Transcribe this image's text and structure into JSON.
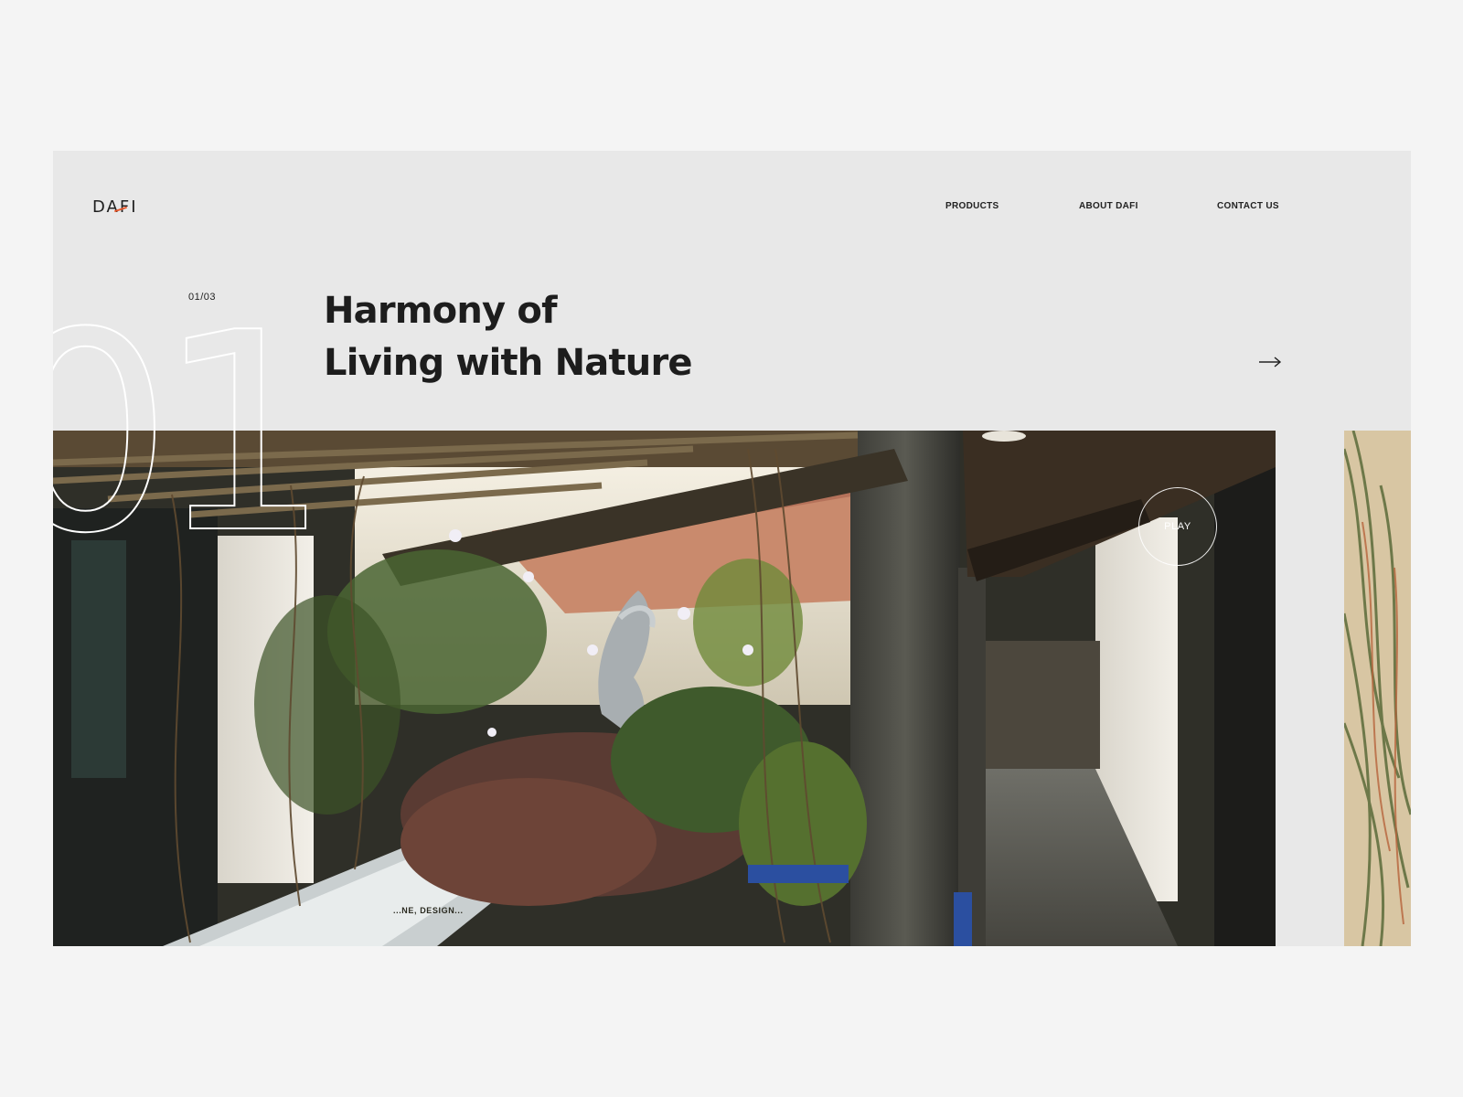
{
  "brand": {
    "logo": "DAFI",
    "accent_color": "#e8572a"
  },
  "nav": {
    "items": [
      {
        "label": "PRODUCTS"
      },
      {
        "label": "ABOUT DAFI"
      },
      {
        "label": "CONTACT US"
      }
    ]
  },
  "slider": {
    "counter": "01/03",
    "big_number": "01",
    "headline_line1": "Harmony of",
    "headline_line2": "Living with Nature",
    "next_icon": "arrow-right-icon",
    "play_label": "PLAY",
    "caption": "...NE, DESIGN..."
  },
  "colors": {
    "page_bg": "#f4f4f4",
    "frame_bg": "#e8e8e8",
    "text": "#1d1d1d"
  }
}
